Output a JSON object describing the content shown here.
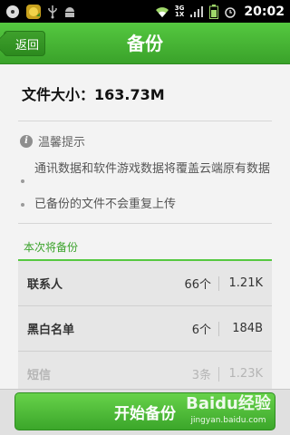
{
  "status_bar": {
    "time": "20:02",
    "network_label_top": "3G",
    "network_label_bottom": "1X"
  },
  "header": {
    "back_label": "返回",
    "title": "备份"
  },
  "file_size": "文件大小：163.73M",
  "tips": {
    "title": "温馨提示",
    "items": [
      "通讯数据和软件游戏数据将覆盖云端原有数据",
      "已备份的文件不会重复上传"
    ]
  },
  "backup_section": {
    "title": "本次将备份",
    "rows": [
      {
        "name": "联系人",
        "count": "66个",
        "size": "1.21K"
      },
      {
        "name": "黑白名单",
        "count": "6个",
        "size": "184B"
      },
      {
        "name": "短信",
        "count": "3条",
        "size": "1.23K"
      }
    ]
  },
  "footer": {
    "start_label": "开始备份"
  },
  "watermark": {
    "main": "Baidu经验",
    "sub": "jingyan.baidu.com"
  }
}
